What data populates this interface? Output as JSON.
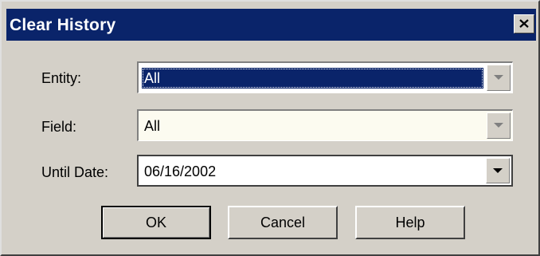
{
  "window": {
    "title": "Clear History",
    "close_icon": "close-icon"
  },
  "form": {
    "entity": {
      "label": "Entity:",
      "value": "All"
    },
    "field": {
      "label": "Field:",
      "value": "All"
    },
    "until_date": {
      "label": "Until Date:",
      "value": "06/16/2002"
    }
  },
  "buttons": {
    "ok": "OK",
    "cancel": "Cancel",
    "help": "Help"
  },
  "colors": {
    "titlebar": "#0a246a",
    "dialog_bg": "#d4d0c8",
    "field_bg": "#fcfbf0"
  }
}
